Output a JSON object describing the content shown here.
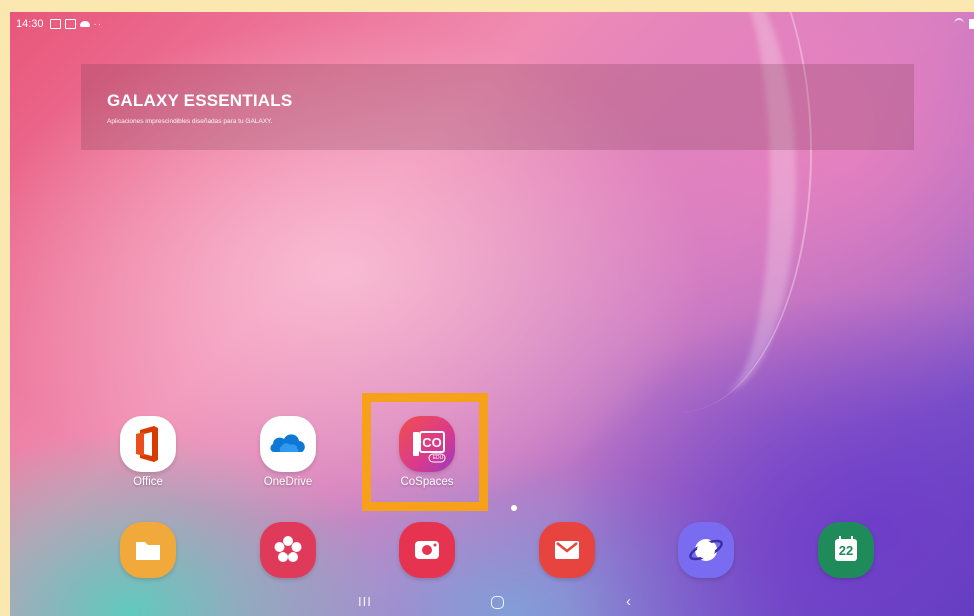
{
  "status_bar": {
    "time": "14:30",
    "icons": [
      "gallery-icon",
      "photo-icon",
      "cloud-icon",
      "dots-icon"
    ],
    "right_icons": [
      "wifi-icon",
      "battery-icon"
    ]
  },
  "widget": {
    "title": "GALAXY ESSENTIALS",
    "subtitle": "Aplicaciones imprescindibles diseñadas para tu GALAXY."
  },
  "home_apps": [
    {
      "label": "Office",
      "icon": "office-icon"
    },
    {
      "label": "OneDrive",
      "icon": "onedrive-icon"
    },
    {
      "label": "CoSpaces",
      "icon": "cospaces-icon",
      "badge": "EDU",
      "highlighted": true
    }
  ],
  "dock_apps": [
    {
      "icon": "my-files-icon"
    },
    {
      "icon": "galaxy-store-icon"
    },
    {
      "icon": "camera-icon"
    },
    {
      "icon": "email-icon"
    },
    {
      "icon": "internet-icon"
    },
    {
      "icon": "calendar-icon",
      "text": "22"
    }
  ],
  "nav_bar": {
    "recent": "III",
    "back": "‹"
  },
  "colors": {
    "highlight": "#f7a11b"
  }
}
